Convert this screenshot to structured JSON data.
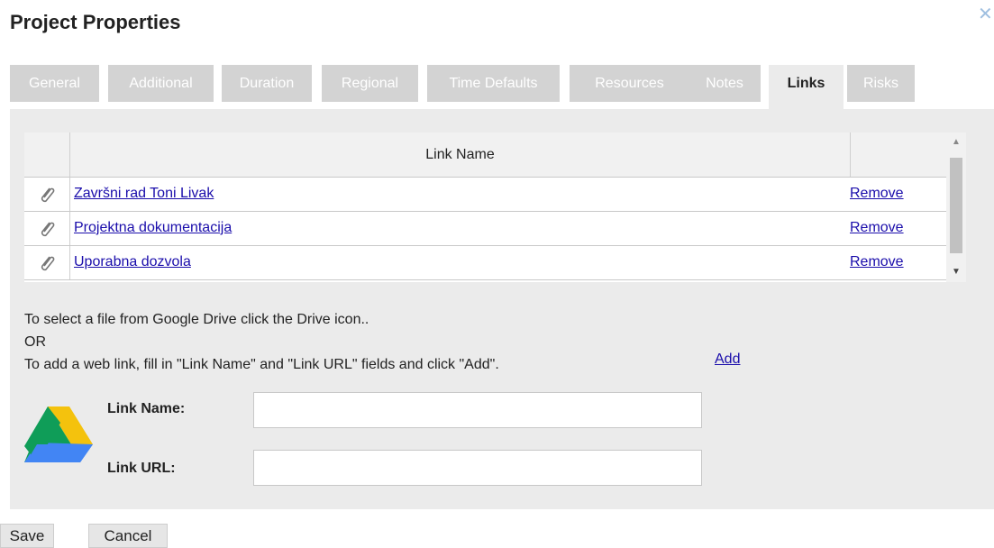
{
  "dialog": {
    "title": "Project Properties",
    "close_icon": "close-x-icon"
  },
  "tabs": [
    {
      "label": "General",
      "active": false
    },
    {
      "label": "Additional",
      "active": false
    },
    {
      "label": "Duration",
      "active": false
    },
    {
      "label": "Regional",
      "active": false
    },
    {
      "label": "Time Defaults",
      "active": false
    },
    {
      "label": "Resources",
      "active": false
    },
    {
      "label": "Notes",
      "active": false
    },
    {
      "label": "Links",
      "active": true
    },
    {
      "label": "Risks",
      "active": false
    }
  ],
  "links_table": {
    "column_header": "Link Name",
    "rows": [
      {
        "icon": "paperclip-icon",
        "name": "Završni rad Toni Livak",
        "action": "Remove"
      },
      {
        "icon": "paperclip-icon",
        "name": "Projektna dokumentacija",
        "action": "Remove"
      },
      {
        "icon": "paperclip-icon",
        "name": "Uporabna dozvola",
        "action": "Remove"
      }
    ]
  },
  "instructions": {
    "line1": "To select a file from Google Drive click the Drive icon..",
    "line2": "OR",
    "line3": "To add a web link, fill in \"Link Name\" and \"Link URL\" fields and click \"Add\"."
  },
  "form": {
    "drive_icon": "google-drive-icon",
    "link_name_label": "Link Name:",
    "link_name_value": "",
    "link_url_label": "Link URL:",
    "link_url_value": "",
    "add_label": "Add"
  },
  "footer": {
    "save_label": "Save",
    "cancel_label": "Cancel"
  },
  "colors": {
    "tab_inactive": "#d3d3d3",
    "panel_bg": "#ebebeb",
    "link_color": "#1a0dab"
  }
}
